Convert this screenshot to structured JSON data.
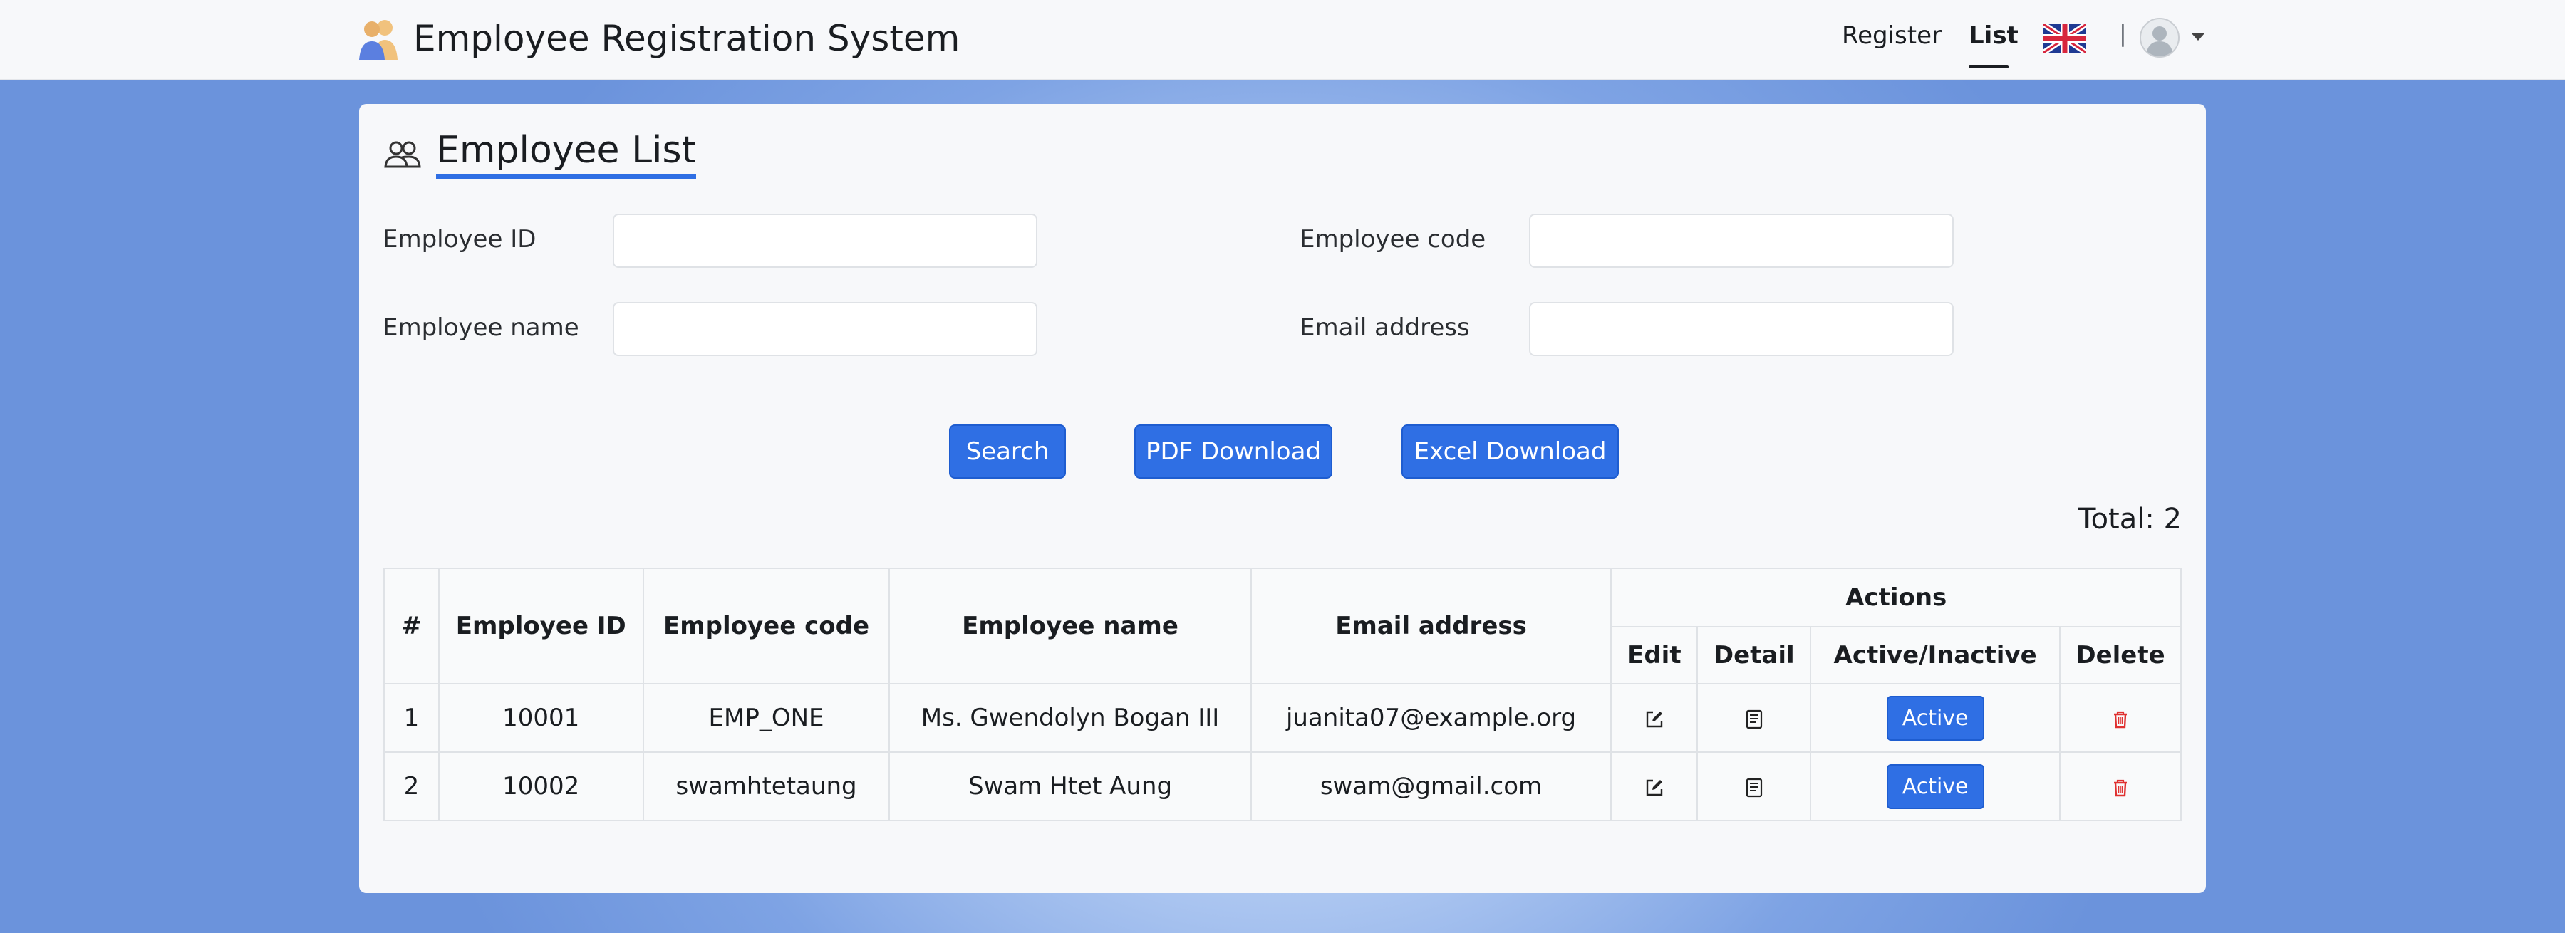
{
  "navbar": {
    "title": "Employee Registration System",
    "brand_icon": "users-icon",
    "links": {
      "register": "Register",
      "list": "List"
    },
    "language_flag": "uk-flag-icon",
    "separator": "|",
    "user_icon": "user-avatar-icon"
  },
  "page": {
    "title": "Employee List",
    "title_icon": "people-icon"
  },
  "search": {
    "employee_id_label": "Employee ID",
    "employee_code_label": "Employee code",
    "employee_name_label": "Employee name",
    "email_label": "Email address",
    "employee_id_value": "",
    "employee_code_value": "",
    "employee_name_value": "",
    "email_value": ""
  },
  "buttons": {
    "search": "Search",
    "pdf": "PDF Download",
    "excel": "Excel Download"
  },
  "total_text": "Total: 2",
  "table": {
    "headers": {
      "index": "#",
      "employee_id": "Employee ID",
      "employee_code": "Employee code",
      "employee_name": "Employee name",
      "email": "Email address",
      "actions": "Actions",
      "edit": "Edit",
      "detail": "Detail",
      "active_inactive": "Active/Inactive",
      "delete": "Delete"
    },
    "rows": [
      {
        "index": "1",
        "employee_id": "10001",
        "employee_code": "EMP_ONE",
        "employee_name": "Ms. Gwendolyn Bogan III",
        "email": "juanita07@example.org",
        "status": "Active"
      },
      {
        "index": "2",
        "employee_id": "10002",
        "employee_code": "swamhtetaung",
        "employee_name": "Swam Htet Aung",
        "email": "swam@gmail.com",
        "status": "Active"
      }
    ]
  },
  "colors": {
    "primary": "#2f6fe4",
    "delete_icon": "#e03131",
    "title_underline": "#2f6fe4"
  }
}
